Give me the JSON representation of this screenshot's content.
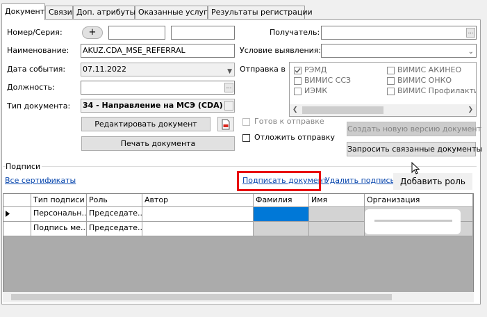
{
  "tabs": [
    "Документ",
    "Связи",
    "Доп. атрибуты",
    "Оказанные услуги",
    "Результаты регистрации"
  ],
  "form": {
    "nomer_label": "Номер/Серия:",
    "plus_label": "+",
    "naim_label": "Наименование:",
    "naim_value": "AKUZ.CDA_MSE_REFERRAL",
    "date_label": "Дата события:",
    "date_value": "07.11.2022",
    "dolzh_label": "Должность:",
    "tipdoc_label": "Тип документа:",
    "tipdoc_value": "34 - Направление на МСЭ (CDA)",
    "poluch_label": "Получатель:",
    "uslovie_label": "Условие выявления:",
    "otpravka_label": "Отправка в",
    "ellipsis": "...",
    "arrow": "▼"
  },
  "send_targets": [
    {
      "label": "РЭМД",
      "checked": true
    },
    {
      "label": "ВИМИС ССЗ",
      "checked": false
    },
    {
      "label": "ИЭМК",
      "checked": false
    },
    {
      "label": "ВИМИС АКИНЕО",
      "checked": false
    },
    {
      "label": "ВИМИС ОНКО",
      "checked": false
    },
    {
      "label": "ВИМИС Профилактик",
      "checked": false
    }
  ],
  "buttons": {
    "edit_doc": "Редактировать документ",
    "print_doc": "Печать документа",
    "create_version": "Создать новую версию документ",
    "request_linked": "Запросить связанные документы",
    "add_role": "Добавить роль"
  },
  "checks": {
    "ready": "Готов к отправке",
    "postpone": "Отложить отправку"
  },
  "signatures": {
    "group_label": "Подписи",
    "all_certs": "Все сертификаты",
    "sign_doc": "Подписать документ",
    "delete_sign": "Удалить подпись",
    "columns": [
      "Тип подписи",
      "Роль",
      "Автор",
      "Фамилия",
      "Имя",
      "Организация"
    ],
    "rows": [
      [
        "Персональн...",
        "Председате..."
      ],
      [
        "Подпись ме...",
        "Председате..."
      ]
    ]
  },
  "colors": {
    "highlight": "#e8000b",
    "selection": "#0078d7",
    "link": "#0645ad"
  }
}
